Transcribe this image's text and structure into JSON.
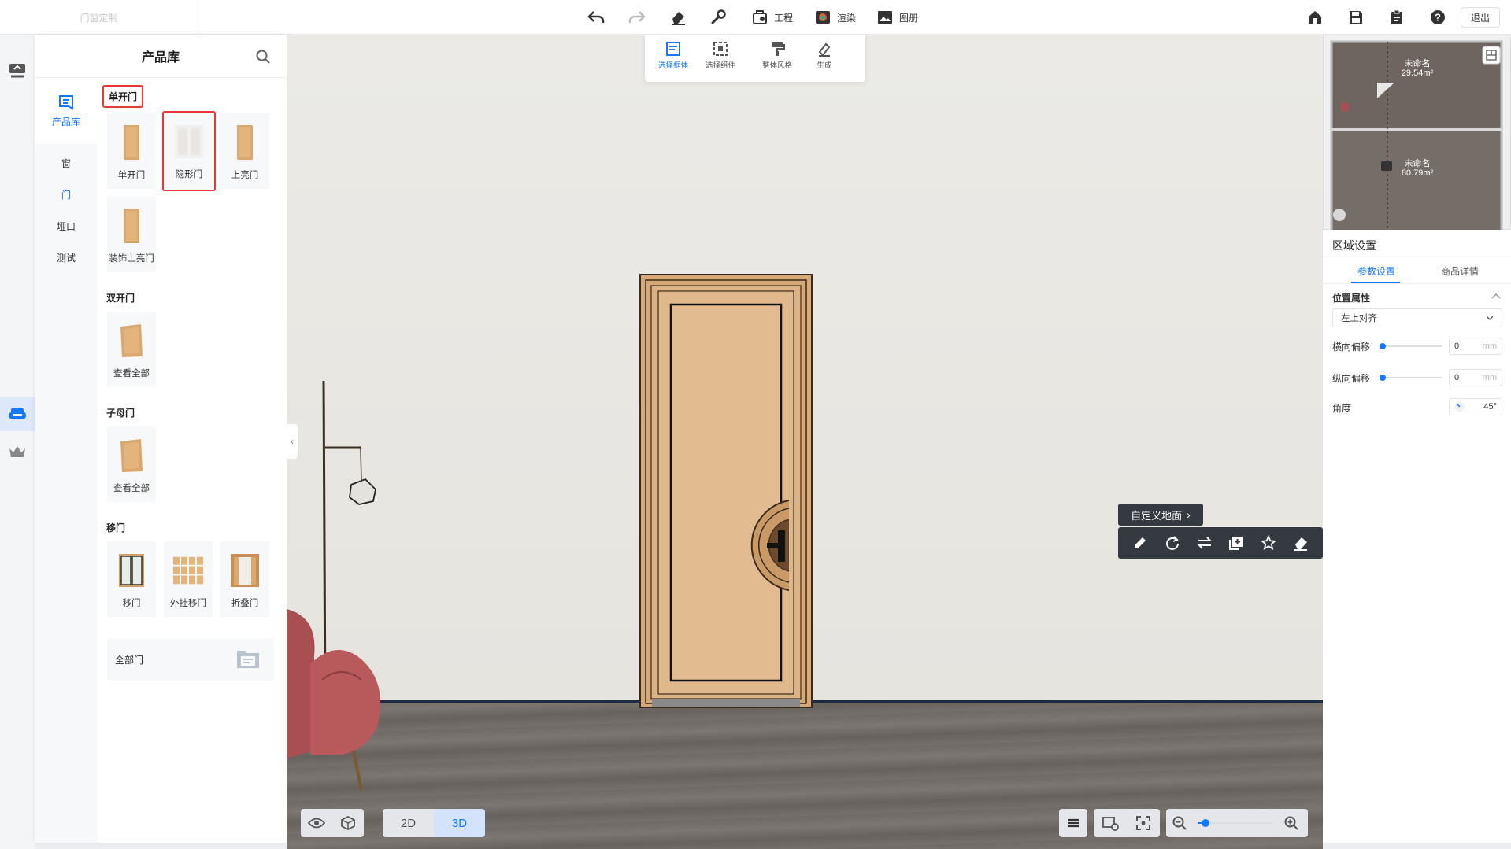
{
  "app": {
    "name": "门窗定制"
  },
  "toolbar": {
    "project_label": "工程",
    "render_label": "渲染",
    "album_label": "图册",
    "exit_label": "退出"
  },
  "product_panel": {
    "title": "产品库",
    "nav": {
      "top_label": "产品库",
      "items": [
        {
          "label": "窗",
          "active": false
        },
        {
          "label": "门",
          "active": true
        },
        {
          "label": "垭口",
          "active": false
        },
        {
          "label": "测试",
          "active": false
        }
      ]
    },
    "sections": [
      {
        "title": "单开门",
        "items": [
          "单开门",
          "隐形门",
          "上亮门",
          "装饰上亮门"
        ]
      },
      {
        "title": "双开门",
        "items": [
          "查看全部"
        ]
      },
      {
        "title": "子母门",
        "items": [
          "查看全部"
        ]
      },
      {
        "title": "移门",
        "items": [
          "移门",
          "外挂移门",
          "折叠门"
        ]
      }
    ],
    "all_doors_label": "全部门"
  },
  "tools": [
    {
      "label": "选择框体",
      "active": true
    },
    {
      "label": "选择组件",
      "active": false
    },
    {
      "label": "整体风格",
      "active": false
    },
    {
      "label": "生成",
      "active": false
    }
  ],
  "context": {
    "custom_floor_label": "自定义地面"
  },
  "view": {
    "mode_2d": "2D",
    "mode_3d": "3D",
    "active_mode": "3D",
    "zoom_fraction": 0.1
  },
  "minimap": {
    "rooms": [
      {
        "name": "未命名",
        "area": "29.54m²"
      },
      {
        "name": "未命名",
        "area": "80.79m²"
      }
    ]
  },
  "region_settings": {
    "title": "区域设置",
    "tabs": [
      "参数设置",
      "商品详情"
    ],
    "active_tab": "参数设置",
    "position_header": "位置属性",
    "alignment_value": "左上对齐",
    "h_offset_label": "横向偏移",
    "h_offset_value": "0",
    "v_offset_label": "纵向偏移",
    "v_offset_value": "0",
    "unit": "mm",
    "angle_label": "角度",
    "angle_value": "45°"
  },
  "colors": {
    "accent": "#1677ff",
    "highlight": "#e53935",
    "dark_bar": "#343a40",
    "door_wood": "#d9ae80"
  }
}
